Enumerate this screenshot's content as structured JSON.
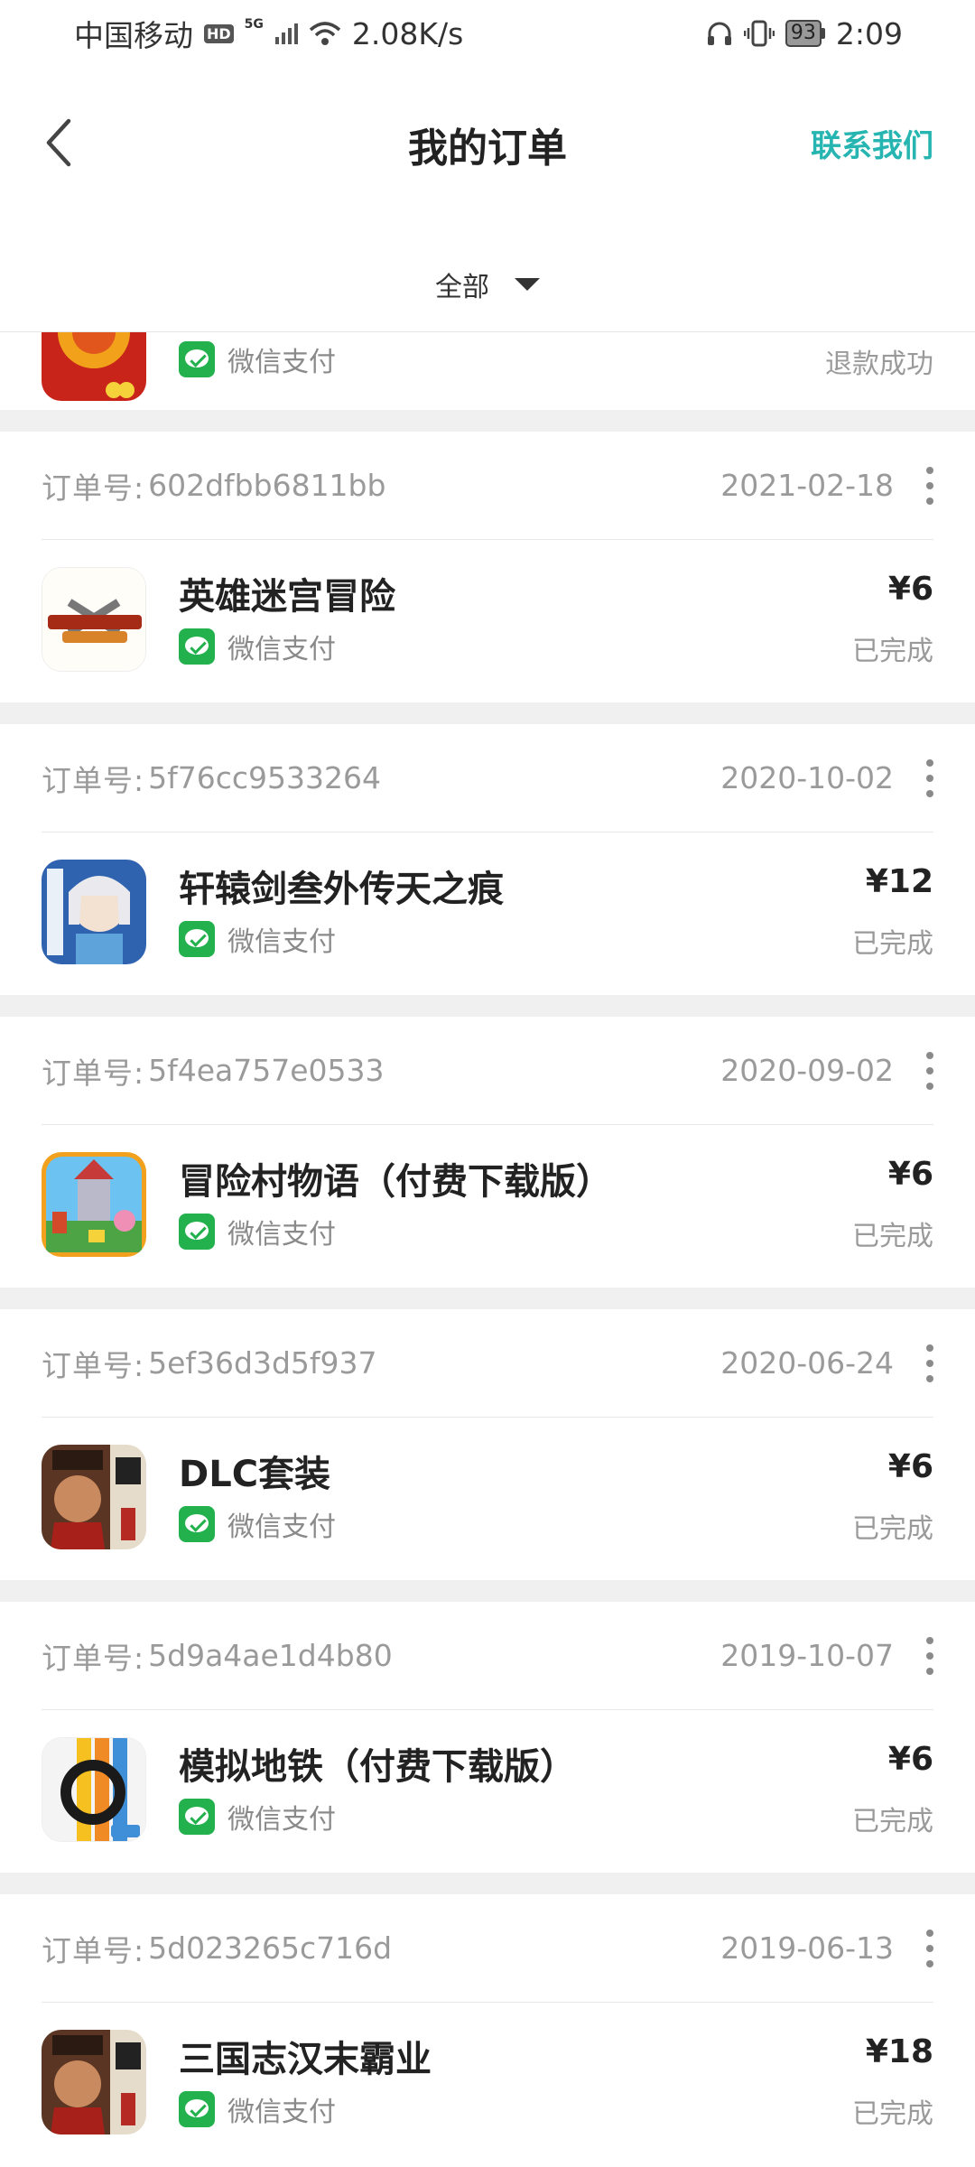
{
  "status_bar": {
    "carrier": "中国移动",
    "hd": "HD",
    "network": "5G",
    "speed": "2.08K/s",
    "battery": "93",
    "time": "2:09"
  },
  "header": {
    "title": "我的订单",
    "contact": "联系我们"
  },
  "filter": {
    "label": "全部"
  },
  "partial_order": {
    "payment": "微信支付",
    "status": "退款成功"
  },
  "order_label": "订单号:",
  "orders": [
    {
      "id": "602dfbb6811bb",
      "date": "2021-02-18",
      "name": "英雄迷宫冒险",
      "payment": "微信支付",
      "price": "¥6",
      "status": "已完成"
    },
    {
      "id": "5f76cc9533264",
      "date": "2020-10-02",
      "name": "轩辕剑叁外传天之痕",
      "payment": "微信支付",
      "price": "¥12",
      "status": "已完成"
    },
    {
      "id": "5f4ea757e0533",
      "date": "2020-09-02",
      "name": "冒险村物语（付费下载版）",
      "payment": "微信支付",
      "price": "¥6",
      "status": "已完成"
    },
    {
      "id": "5ef36d3d5f937",
      "date": "2020-06-24",
      "name": "DLC套装",
      "payment": "微信支付",
      "price": "¥6",
      "status": "已完成"
    },
    {
      "id": "5d9a4ae1d4b80",
      "date": "2019-10-07",
      "name": "模拟地铁（付费下载版）",
      "payment": "微信支付",
      "price": "¥6",
      "status": "已完成"
    },
    {
      "id": "5d023265c716d",
      "date": "2019-06-13",
      "name": "三国志汉末霸业",
      "payment": "微信支付",
      "price": "¥18",
      "status": "已完成"
    }
  ],
  "icons": {
    "brand": "#26b5b0",
    "wechat": "#22b14c"
  }
}
